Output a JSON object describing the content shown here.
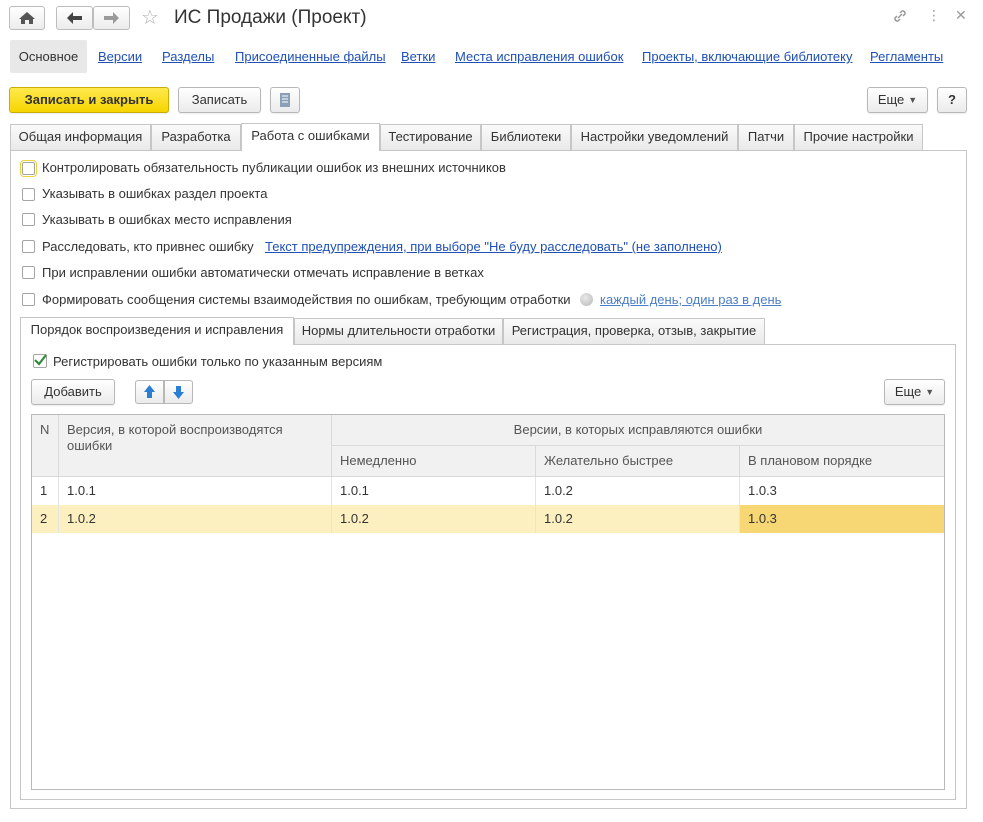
{
  "window": {
    "title": "ИС Продажи (Проект)"
  },
  "nav": {
    "active": "Основное",
    "links": [
      "Версии",
      "Разделы",
      "Присоединенные файлы",
      "Ветки",
      "Места исправления ошибок",
      "Проекты, включающие библиотеку",
      "Регламенты"
    ]
  },
  "toolbar": {
    "save_close": "Записать и закрыть",
    "save": "Записать",
    "more": "Еще",
    "help": "?"
  },
  "tabs": [
    "Общая информация",
    "Разработка",
    "Работа с ошибками",
    "Тестирование",
    "Библиотеки",
    "Настройки уведомлений",
    "Патчи",
    "Прочие настройки"
  ],
  "settings": {
    "opt1": {
      "label": "Контролировать обязательность публикации ошибок из внешних источников",
      "checked": false
    },
    "opt2": {
      "label": "Указывать в ошибках раздел проекта",
      "checked": false
    },
    "opt3": {
      "label": "Указывать в ошибках место исправления",
      "checked": false
    },
    "opt4": {
      "label": "Расследовать, кто привнес ошибку",
      "checked": false,
      "link": "Текст предупреждения, при выборе \"Не буду расследовать\" (не заполнено)"
    },
    "opt5": {
      "label": "При исправлении ошибки автоматически отмечать исправление в ветках",
      "checked": false
    },
    "opt6": {
      "label": "Формировать сообщения системы взаимодействия по ошибкам, требующим отработки",
      "checked": false,
      "link": "каждый день; один раз в день"
    }
  },
  "inner_tabs": [
    "Порядок воспроизведения и исправления",
    "Нормы длительности отработки",
    "Регистрация, проверка, отзыв, закрытие"
  ],
  "inner": {
    "register_label": "Регистрировать ошибки только по указанным версиям",
    "register_checked": true,
    "add": "Добавить",
    "more": "Еще"
  },
  "table": {
    "col_n": "N",
    "col_version": "Версия, в которой воспроизводятся ошибки",
    "group_header": "Версии, в которых исправляются ошибки",
    "col_immediate": "Немедленно",
    "col_faster": "Желательно быстрее",
    "col_planned": "В плановом порядке",
    "rows": [
      {
        "n": "1",
        "version": "1.0.1",
        "immediate": "1.0.1",
        "faster": "1.0.2",
        "planned": "1.0.3"
      },
      {
        "n": "2",
        "version": "1.0.2",
        "immediate": "1.0.2",
        "faster": "1.0.2",
        "planned": "1.0.3"
      }
    ]
  },
  "colors": {
    "link": "#1f50b5",
    "primary_button": "#f7d500",
    "selected_row": "#fcf0c0",
    "selected_cell": "#f7d774",
    "checkmark": "#2e8b3a",
    "arrow": "#2a7fd4"
  }
}
